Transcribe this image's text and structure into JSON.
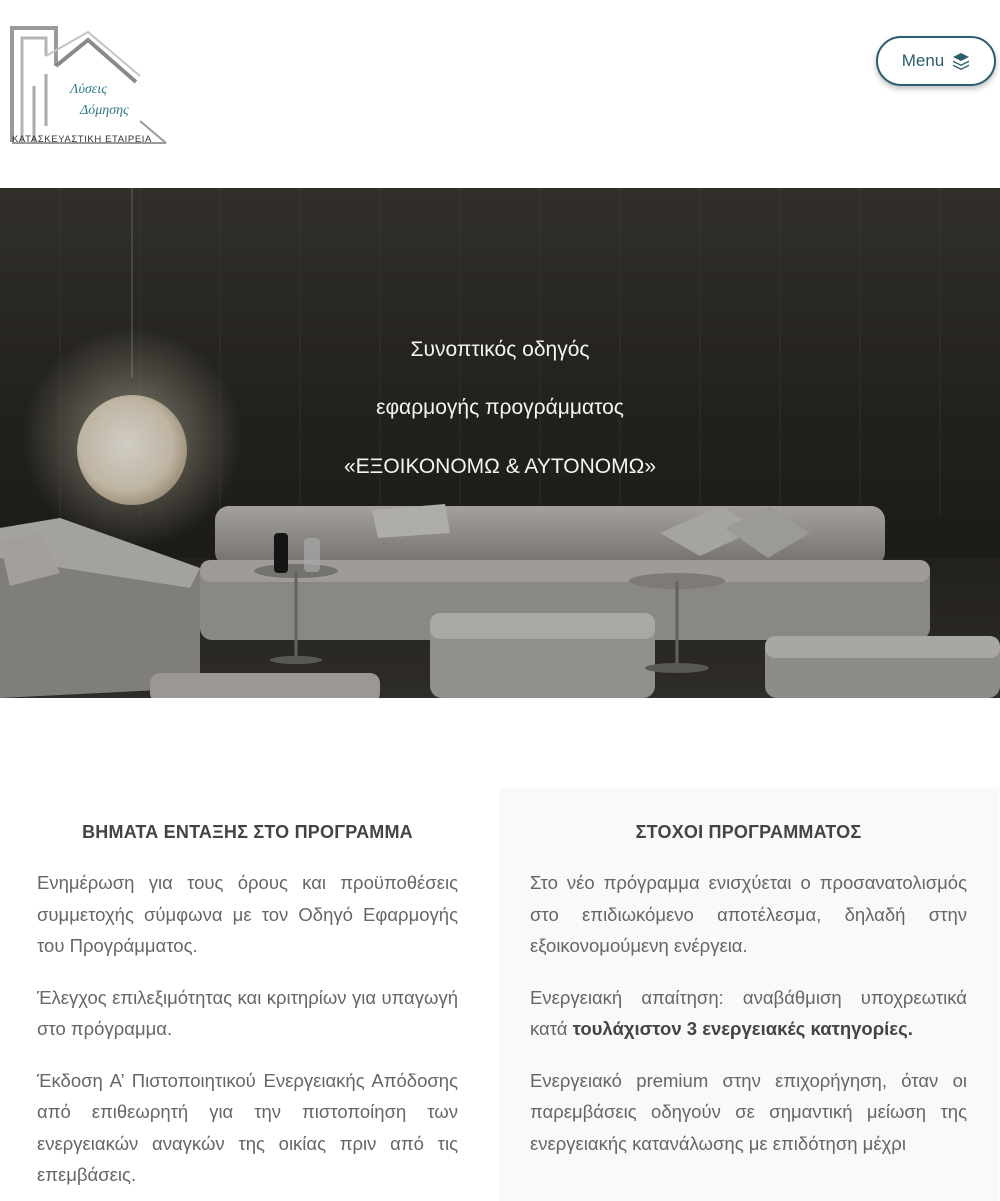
{
  "header": {
    "logo": {
      "line1": "Λύσεις",
      "line2": "Δόμησης",
      "subtitle": "ΚΑΤΑΣΚΕΥΑΣΤΙΚΗ ΕΤΑΙΡΕΙΑ"
    },
    "menu_label": "Menu",
    "menu_icon": "layers-icon"
  },
  "hero": {
    "line1": "Συνοπτικός οδηγός",
    "line2": "εφαρμογής προγράμματος",
    "line3": "«ΕΞΟΙΚΟΝΟΜΩ & ΑΥΤΟΝΟΜΩ»"
  },
  "left_column": {
    "title": "ΒΗΜΑΤΑ ΕΝΤΑΞΗΣ ΣΤΟ ΠΡΟΓΡΑΜΜΑ",
    "paragraphs": [
      "Ενημέρωση για τους όρους και προϋποθέσεις συμμετοχής σύμφωνα με τον Οδηγό Εφαρμογής του Προγράμματος.",
      "Έλεγχος επιλεξιμότητας και κριτηρίων για υπαγωγή στο πρόγραμμα.",
      "Έκδοση Α’ Πιστοποιητικού Ενεργειακής Απόδοσης από επιθεωρητή για την πιστοποίηση των ενεργειακών αναγκών της οικίας πριν από τις επεμβάσεις."
    ]
  },
  "right_column": {
    "title": "ΣΤΟΧΟΙ ΠΡΟΓΡΑΜΜΑΤΟΣ",
    "p1": "Στο νέο πρόγραμμα ενισχύεται ο προσανατολισμός στο επιδιωκόμενο αποτέλεσμα, δηλαδή στην εξοικονομούμενη ενέργεια.",
    "p2_text": "Ενεργειακή απαίτηση: αναβάθμιση υποχρεωτικά κατά ",
    "p2_bold": "τουλάχιστον 3 ενεργειακές κατηγορίες.",
    "p3": "Ενεργειακό premium στην επιχορήγηση, όταν οι παρεμβάσεις οδηγούν σε σημαντική μείωση της ενεργειακής κατανάλωσης με επιδότηση μέχρι"
  }
}
